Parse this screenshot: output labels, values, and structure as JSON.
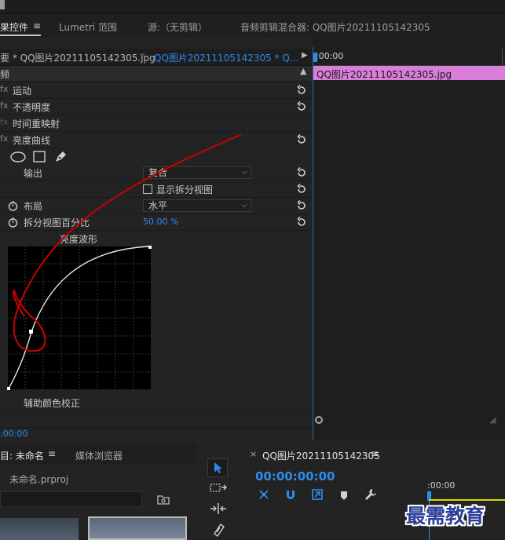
{
  "tabs": {
    "effect_controls": "果控件",
    "lumetri_scopes": "Lumetri 范围",
    "source": "源:（无剪辑）",
    "audio_mixer": "音频剪辑混合器: QQ图片20211105142305"
  },
  "effect_controls": {
    "clip_selector_master": "要 * QQ图片20211105142305.jpg",
    "clip_selector_seq": "QQ图片20211105142305 * Q...",
    "section_label": "频",
    "properties": [
      "运动",
      "不透明度",
      "时间重映射",
      "亮度曲线"
    ],
    "output_label": "输出",
    "output_value": "复合",
    "split_view_label": "显示拆分视图",
    "layout_label": "布局",
    "layout_value": "水平",
    "split_percent_label": "拆分视图百分比",
    "split_percent_value": "50.00 %",
    "curve_title": "亮度波形",
    "secondary_label": "辅助颜色校正",
    "timecode": ":00:00"
  },
  "mini_timeline": {
    "ruler_start": ":00:00",
    "clip_name": "QQ图片20211105142305.jpg",
    "clip_color": "#d97fd9"
  },
  "project_panel": {
    "tab_project": "目: 未命名",
    "tab_media_browser": "媒体浏览器",
    "project_file": "未命名.prproj"
  },
  "sequence_panel": {
    "title": "QQ图片20211105142305",
    "timecode": "00:00:00:00",
    "ruler_start": ":00:00"
  },
  "watermark": "最需教育",
  "colors": {
    "accent_blue": "#2d8ceb",
    "clip_pink": "#d97fd9",
    "annotation_red": "#cc0000"
  }
}
